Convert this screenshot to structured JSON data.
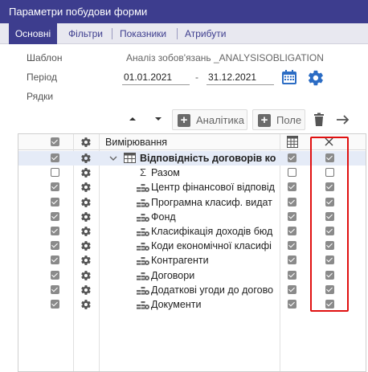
{
  "window": {
    "title": "Параметри побудови форми"
  },
  "tabs": [
    {
      "label": "Основні",
      "active": true
    },
    {
      "label": "Фільтри",
      "active": false
    },
    {
      "label": "Показники",
      "active": false
    },
    {
      "label": "Атрибути",
      "active": false
    }
  ],
  "form": {
    "template_label": "Шаблон",
    "template_value": "Аналіз зобов'язань _ANALYSISOBLIGATION",
    "period_label": "Період",
    "date_from": "01.01.2021",
    "date_separator": "-",
    "date_to": "31.12.2021",
    "rows_label": "Рядки"
  },
  "toolbar": {
    "analytics_label": "Аналітика",
    "field_label": "Поле"
  },
  "grid": {
    "header_label": "Вимірювання",
    "rows": [
      {
        "label": "Відповідність договорів кош",
        "icon": "table",
        "check1": true,
        "check2": true,
        "check3": true,
        "expanded": true,
        "selected": true
      },
      {
        "label": "Разом",
        "icon": "sigma",
        "check1": false,
        "check2": false,
        "check3": false
      },
      {
        "label": "Центр фінансової відповід",
        "icon": "dimension",
        "check1": true,
        "check2": true,
        "check3": true
      },
      {
        "label": "Програмна класиф. видат",
        "icon": "dimension",
        "check1": true,
        "check2": true,
        "check3": true
      },
      {
        "label": "Фонд",
        "icon": "dimension",
        "check1": true,
        "check2": true,
        "check3": true
      },
      {
        "label": "Класифікація доходів бюд",
        "icon": "dimension",
        "check1": true,
        "check2": true,
        "check3": true
      },
      {
        "label": "Коди економічної класифі",
        "icon": "dimension",
        "check1": true,
        "check2": true,
        "check3": true
      },
      {
        "label": "Контрагенти",
        "icon": "dimension",
        "check1": true,
        "check2": true,
        "check3": true
      },
      {
        "label": "Договори",
        "icon": "dimension",
        "check1": true,
        "check2": true,
        "check3": true
      },
      {
        "label": "Додаткові угоди до догово",
        "icon": "dimension",
        "check1": true,
        "check2": true,
        "check3": true
      },
      {
        "label": "Документи",
        "icon": "dimension",
        "check1": true,
        "check2": true,
        "check3": true
      }
    ]
  },
  "colors": {
    "header": "#3d3d8e",
    "highlight": "#e01010",
    "selected_row": "#e5ebf7"
  }
}
